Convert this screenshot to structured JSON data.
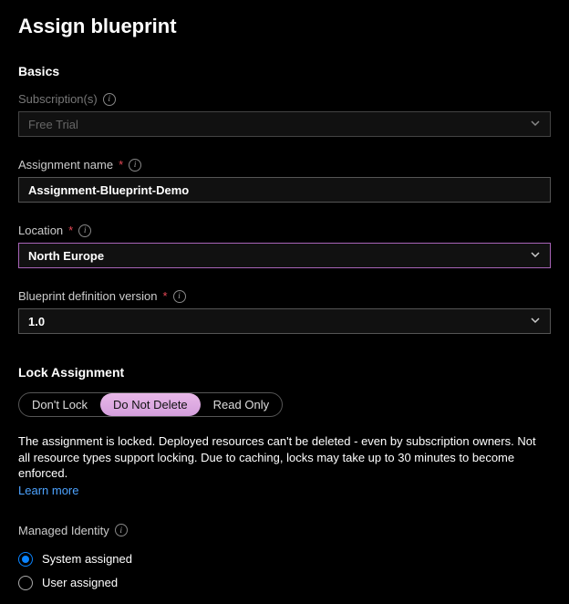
{
  "page": {
    "title": "Assign blueprint"
  },
  "basics": {
    "section_title": "Basics",
    "subscription": {
      "label": "Subscription(s)",
      "value": "Free Trial"
    },
    "assignment_name": {
      "label": "Assignment name",
      "value": "Assignment-Blueprint-Demo"
    },
    "location": {
      "label": "Location",
      "value": "North Europe"
    },
    "version": {
      "label": "Blueprint definition version",
      "value": "1.0"
    }
  },
  "lock": {
    "section_title": "Lock Assignment",
    "options": {
      "dont_lock": "Don't Lock",
      "do_not_delete": "Do Not Delete",
      "read_only": "Read Only"
    },
    "description": "The assignment is locked. Deployed resources can't be deleted - even by subscription owners. Not all resource types support locking. Due to caching, locks may take up to 30 minutes to become enforced.",
    "learn_more": "Learn more"
  },
  "identity": {
    "label": "Managed Identity",
    "system": "System assigned",
    "user": "User assigned"
  }
}
